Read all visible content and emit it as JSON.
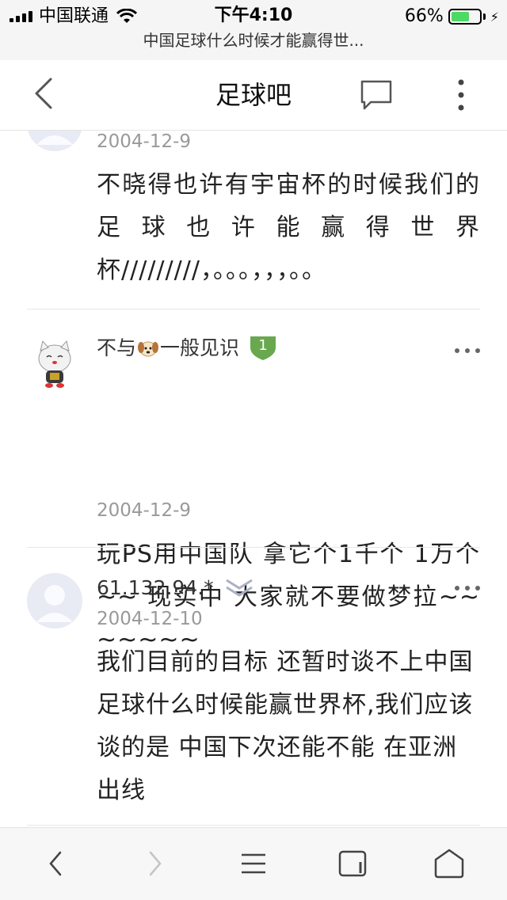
{
  "status_bar": {
    "carrier": "中国联通",
    "time": "下午4:10",
    "battery_percent": "66%",
    "battery_level": 0.66,
    "page_title": "中国足球什么时候才能赢得世..."
  },
  "nav": {
    "title": "足球吧",
    "icons": [
      "back-icon",
      "comment-icon",
      "more-vertical-icon"
    ]
  },
  "posts": [
    {
      "date": "2004-12-9",
      "text": "不晓得也许有宇宙杯的时候我们的足球也许能赢得世界杯/////////，。。。，，，。。"
    },
    {
      "username_pre": "不与",
      "username_post": "一般见识",
      "badge": "1",
      "date": "2004-12-9",
      "text": "玩PS用中国队 拿它个1千个 1万个 ~~ 现实中 大家就不要做梦拉~~~~~~~"
    },
    {
      "username": "61.132.94.*",
      "date": "2004-12-10",
      "text": "我们目前的目标 还暂时谈不上中国足球什么时候能赢世界杯,我们应该谈的是 中国下次还能不能 在亚洲出线"
    }
  ],
  "toolbar": {
    "icons": [
      "back-arrow-icon",
      "forward-arrow-icon",
      "menu-icon",
      "tabs-icon",
      "home-icon"
    ]
  },
  "colors": {
    "status_bg": "#f5f5f5",
    "badge_green": "#6aa84f",
    "battery_green": "#4cd964",
    "date_gray": "#999999"
  }
}
